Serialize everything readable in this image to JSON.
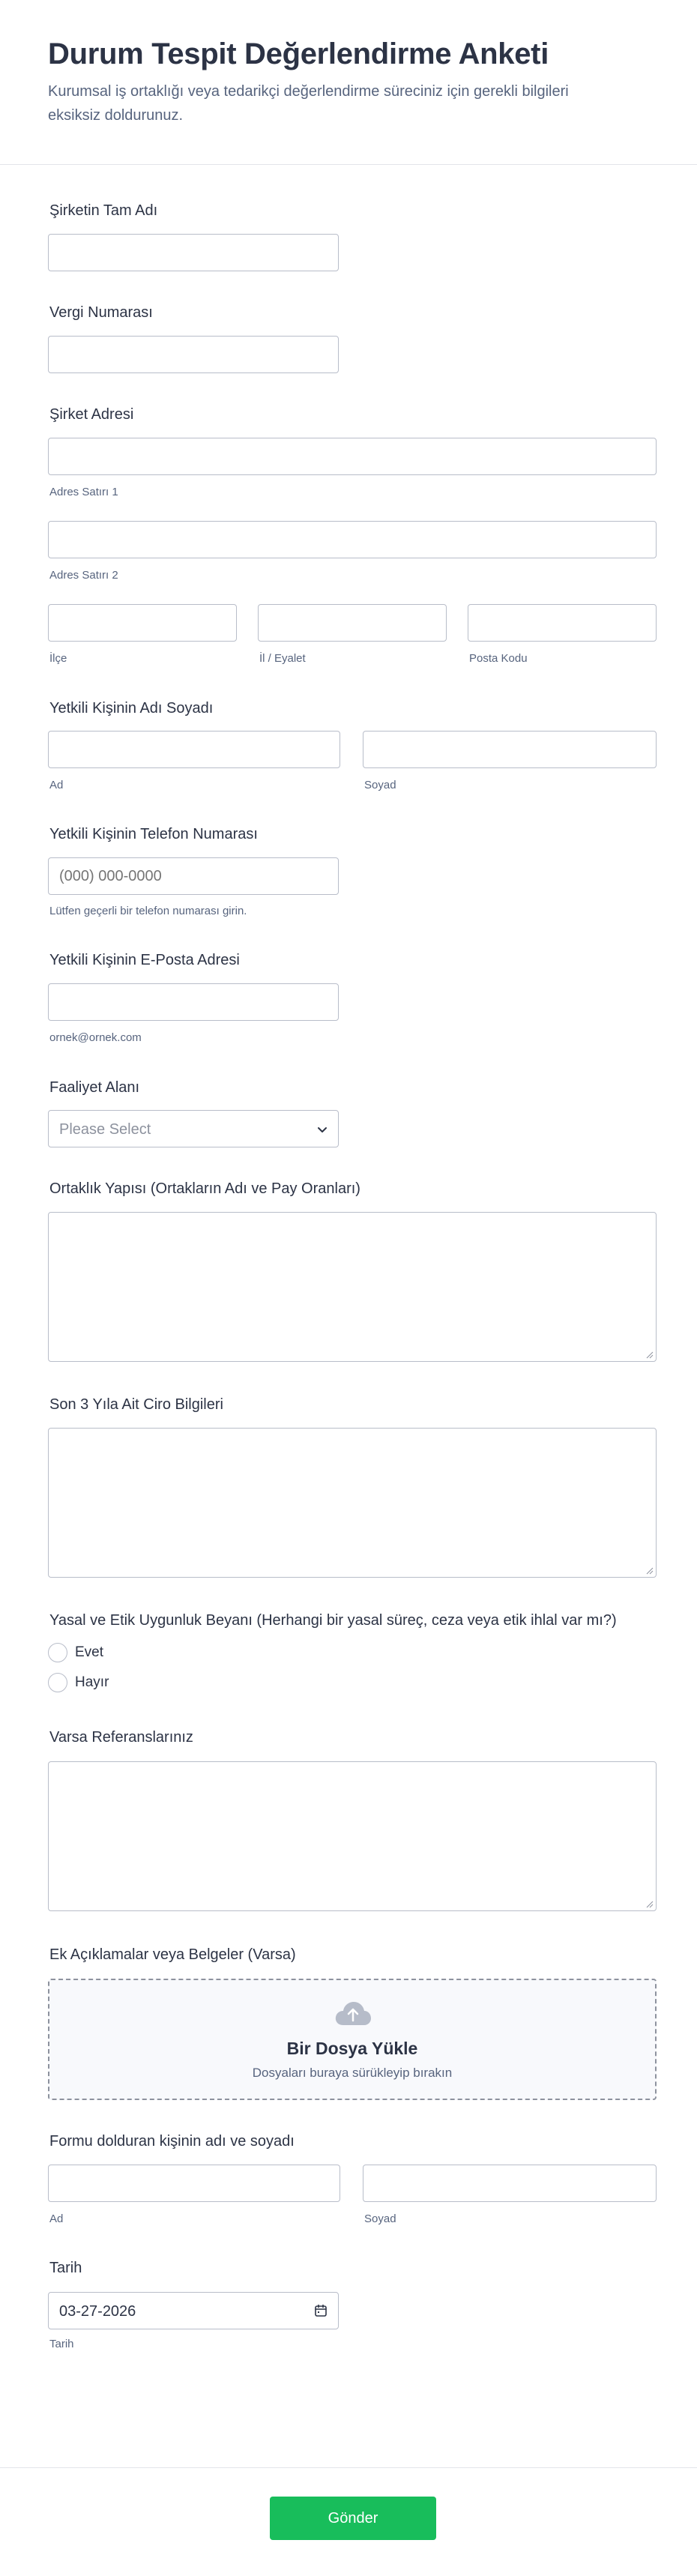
{
  "header": {
    "title": "Durum Tespit Değerlendirme Anketi",
    "subtitle": "Kurumsal iş ortaklığı veya tedarikçi değerlendirme süreciniz için gerekli bilgileri eksiksiz doldurunuz."
  },
  "fields": {
    "company_name": {
      "label": "Şirketin Tam Adı",
      "value": ""
    },
    "tax_number": {
      "label": "Vergi Numarası",
      "value": ""
    },
    "address": {
      "label": "Şirket Adresi",
      "line1_sub": "Adres Satırı 1",
      "line2_sub": "Adres Satırı 2",
      "district_sub": "İlçe",
      "province_sub": "İl / Eyalet",
      "postal_sub": "Posta Kodu"
    },
    "contact_name": {
      "label": "Yetkili Kişinin Adı Soyadı",
      "first_sub": "Ad",
      "last_sub": "Soyad"
    },
    "contact_phone": {
      "label": "Yetkili Kişinin Telefon Numarası",
      "placeholder": "(000) 000-0000",
      "hint": "Lütfen geçerli bir telefon numarası girin."
    },
    "contact_email": {
      "label": "Yetkili Kişinin E-Posta Adresi",
      "hint": "ornek@ornek.com"
    },
    "activity": {
      "label": "Faaliyet Alanı",
      "placeholder": "Please Select"
    },
    "partnership": {
      "label": "Ortaklık Yapısı (Ortakların Adı ve Pay Oranları)"
    },
    "revenue": {
      "label": "Son 3 Yıla Ait Ciro Bilgileri"
    },
    "compliance": {
      "label": "Yasal ve Etik Uygunluk Beyanı (Herhangi bir yasal süreç, ceza veya etik ihlal var mı?)",
      "options": [
        "Evet",
        "Hayır"
      ]
    },
    "references": {
      "label": "Varsa Referanslarınız"
    },
    "attachments": {
      "label": "Ek Açıklamalar veya Belgeler (Varsa)",
      "upload_title": "Bir Dosya Yükle",
      "upload_sub": "Dosyaları buraya sürükleyip bırakın",
      "icon": "cloud-upload-icon"
    },
    "filler_name": {
      "label": "Formu dolduran kişinin adı ve soyadı",
      "first_sub": "Ad",
      "last_sub": "Soyad"
    },
    "date": {
      "label": "Tarih",
      "value": "03-27-2026",
      "sub": "Tarih",
      "icon": "calendar-icon"
    }
  },
  "footer": {
    "submit_label": "Gönder"
  },
  "colors": {
    "accent": "#18bd5b",
    "text": "#2c3345",
    "muted": "#57647e",
    "border": "#b8bdc9"
  }
}
